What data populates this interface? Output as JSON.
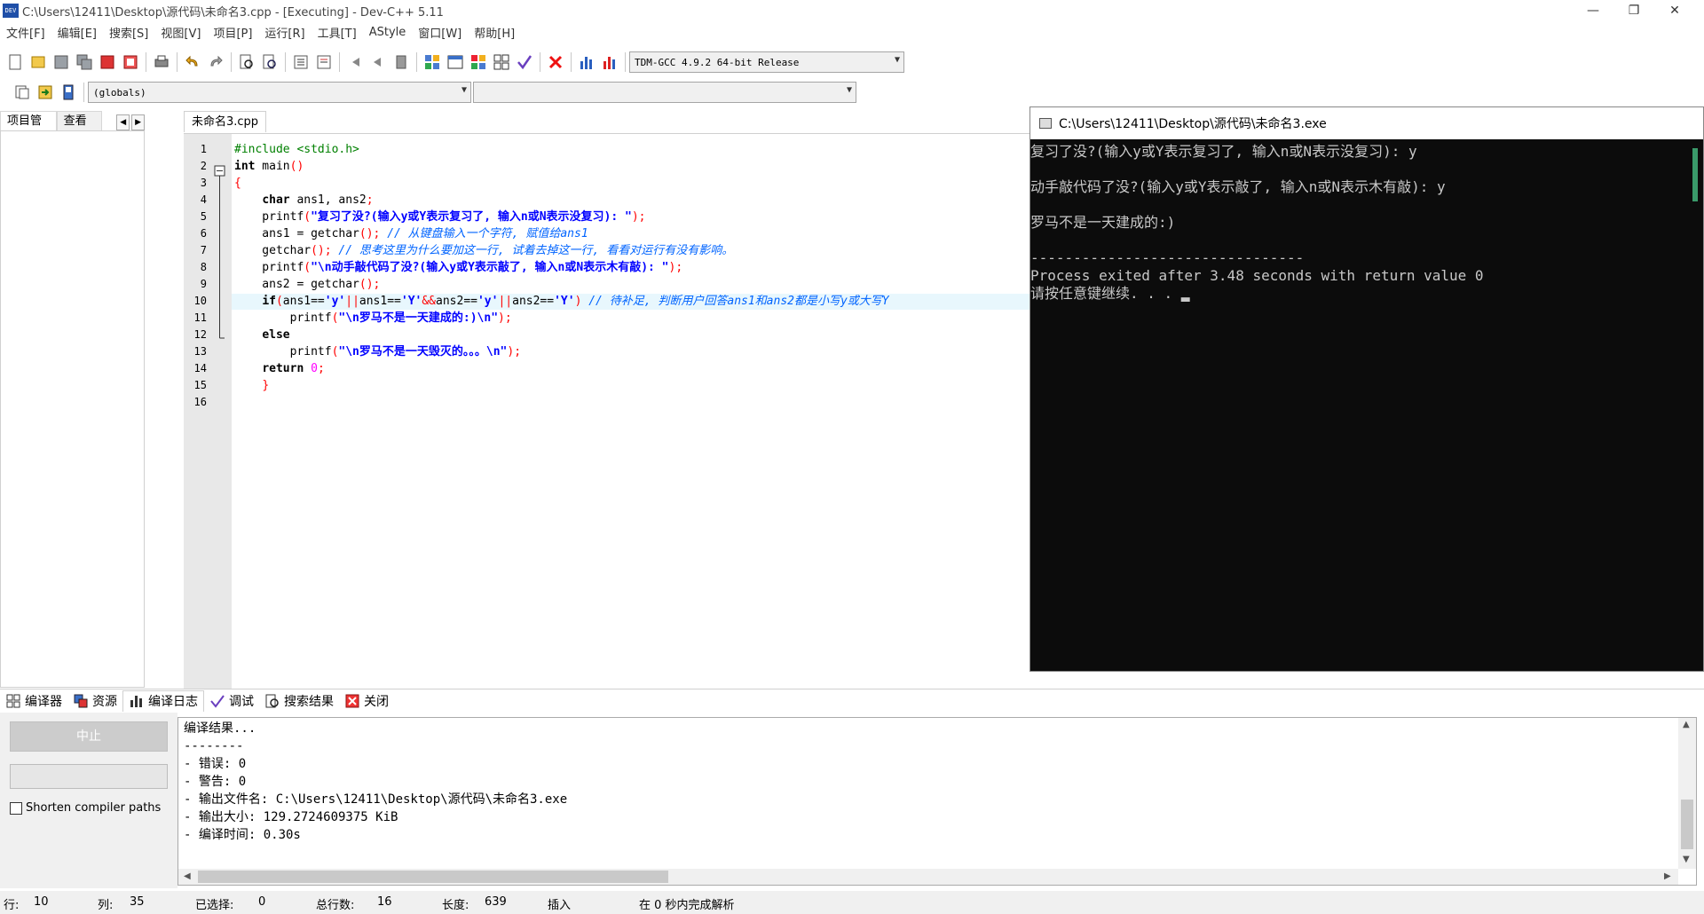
{
  "window": {
    "title": "C:\\Users\\12411\\Desktop\\源代码\\未命名3.cpp - [Executing] - Dev-C++ 5.11",
    "icon_text": "DEV"
  },
  "menu": [
    "文件[F]",
    "编辑[E]",
    "搜索[S]",
    "视图[V]",
    "项目[P]",
    "运行[R]",
    "工具[T]",
    "AStyle",
    "窗口[W]",
    "帮助[H]"
  ],
  "toolbar": {
    "compiler_select": "TDM-GCC 4.9.2 64-bit Release",
    "scope_select": "(globals)",
    "function_select": ""
  },
  "left_tabs": [
    "项目管理",
    "查看类"
  ],
  "editor": {
    "tab_label": "未命名3.cpp",
    "line_numbers": [
      "1",
      "2",
      "3",
      "4",
      "5",
      "6",
      "7",
      "8",
      "9",
      "10",
      "11",
      "12",
      "13",
      "14",
      "15",
      "16"
    ],
    "lines": [
      [
        [
          "pp",
          "#include <stdio.h>"
        ]
      ],
      [
        [
          "kw",
          "int"
        ],
        [
          "chr",
          " main"
        ],
        [
          "sym",
          "()"
        ]
      ],
      [
        [
          "sym",
          "{"
        ]
      ],
      [
        [
          "chr",
          "    "
        ],
        [
          "kw",
          "char"
        ],
        [
          "chr",
          " ans1, ans2"
        ],
        [
          "sym",
          ";"
        ]
      ],
      [
        [
          "chr",
          "    printf"
        ],
        [
          "sym",
          "("
        ],
        [
          "str",
          "\"复习了没?(输入y或Y表示复习了, 输入n或N表示没复习): \""
        ],
        [
          "sym",
          ");"
        ]
      ],
      [
        [
          "chr",
          "    ans1 = getchar"
        ],
        [
          "sym",
          "();"
        ],
        [
          "cmt",
          " // 从键盘输入一个字符, 赋值给ans1"
        ]
      ],
      [
        [
          "chr",
          "    getchar"
        ],
        [
          "sym",
          "();"
        ],
        [
          "cmt",
          " // 思考这里为什么要加这一行, 试着去掉这一行, 看看对运行有没有影响。"
        ]
      ],
      [
        [
          "chr",
          "    printf"
        ],
        [
          "sym",
          "("
        ],
        [
          "str",
          "\"\\n动手敲代码了没?(输入y或Y表示敲了, 输入n或N表示木有敲): \""
        ],
        [
          "sym",
          ");"
        ]
      ],
      [
        [
          "chr",
          "    ans2 = getchar"
        ],
        [
          "sym",
          "();"
        ]
      ],
      [
        [
          "chr",
          "    "
        ],
        [
          "kw",
          "if"
        ],
        [
          "sym",
          "("
        ],
        [
          "chr",
          "ans1=="
        ],
        [
          "str",
          "'y'"
        ],
        [
          "sym",
          "||"
        ],
        [
          "chr",
          "ans1=="
        ],
        [
          "str",
          "'Y'"
        ],
        [
          "sym",
          "&&"
        ],
        [
          "chr",
          "ans2=="
        ],
        [
          "str",
          "'y'"
        ],
        [
          "sym",
          "||"
        ],
        [
          "chr",
          "ans2=="
        ],
        [
          "str",
          "'Y'"
        ],
        [
          "sym",
          ")"
        ],
        [
          "cmt",
          " // 待补足, 判断用户回答ans1和ans2都是小写y或大写Y"
        ]
      ],
      [
        [
          "chr",
          "        printf"
        ],
        [
          "sym",
          "("
        ],
        [
          "str",
          "\"\\n罗马不是一天建成的:)\\n\""
        ],
        [
          "sym",
          ");"
        ]
      ],
      [
        [
          "chr",
          "    "
        ],
        [
          "kw",
          "else"
        ]
      ],
      [
        [
          "chr",
          "        printf"
        ],
        [
          "sym",
          "("
        ],
        [
          "str",
          "\"\\n罗马不是一天毁灭的。。。\\n\""
        ],
        [
          "sym",
          ");"
        ]
      ],
      [
        [
          "chr",
          "    "
        ],
        [
          "kw",
          "return"
        ],
        [
          "chr",
          " "
        ],
        [
          "num",
          "0"
        ],
        [
          "sym",
          ";"
        ]
      ],
      [
        [
          "chr",
          "    "
        ],
        [
          "sym",
          "}"
        ]
      ],
      [
        [
          "chr",
          ""
        ]
      ]
    ]
  },
  "console": {
    "title": "C:\\Users\\12411\\Desktop\\源代码\\未命名3.exe",
    "lines": [
      "复习了没?(输入y或Y表示复习了, 输入n或N表示没复习): y",
      "",
      "动手敲代码了没?(输入y或Y表示敲了, 输入n或N表示木有敲): y",
      "",
      "罗马不是一天建成的:)",
      "",
      "--------------------------------",
      "Process exited after 3.48 seconds with return value 0",
      "请按任意键继续. . . ▂"
    ]
  },
  "bottom_tabs": [
    "编译器",
    "资源",
    "编译日志",
    "调试",
    "搜索结果",
    "关闭"
  ],
  "bottom_left": {
    "stop_label": "中止",
    "shorten_label": "Shorten compiler paths"
  },
  "log": [
    "编译结果...",
    "--------",
    "- 错误: 0",
    "- 警告: 0",
    "- 输出文件名: C:\\Users\\12411\\Desktop\\源代码\\未命名3.exe",
    "- 输出大小: 129.2724609375 KiB",
    "- 编译时间: 0.30s"
  ],
  "status": {
    "row_label": "行:",
    "row_value": "10",
    "col_label": "列:",
    "col_value": "35",
    "sel_label": "已选择:",
    "sel_value": "0",
    "lines_label": "总行数:",
    "lines_value": "16",
    "len_label": "长度:",
    "len_value": "639",
    "mode": "插入",
    "parse": "在 0 秒内完成解析"
  }
}
